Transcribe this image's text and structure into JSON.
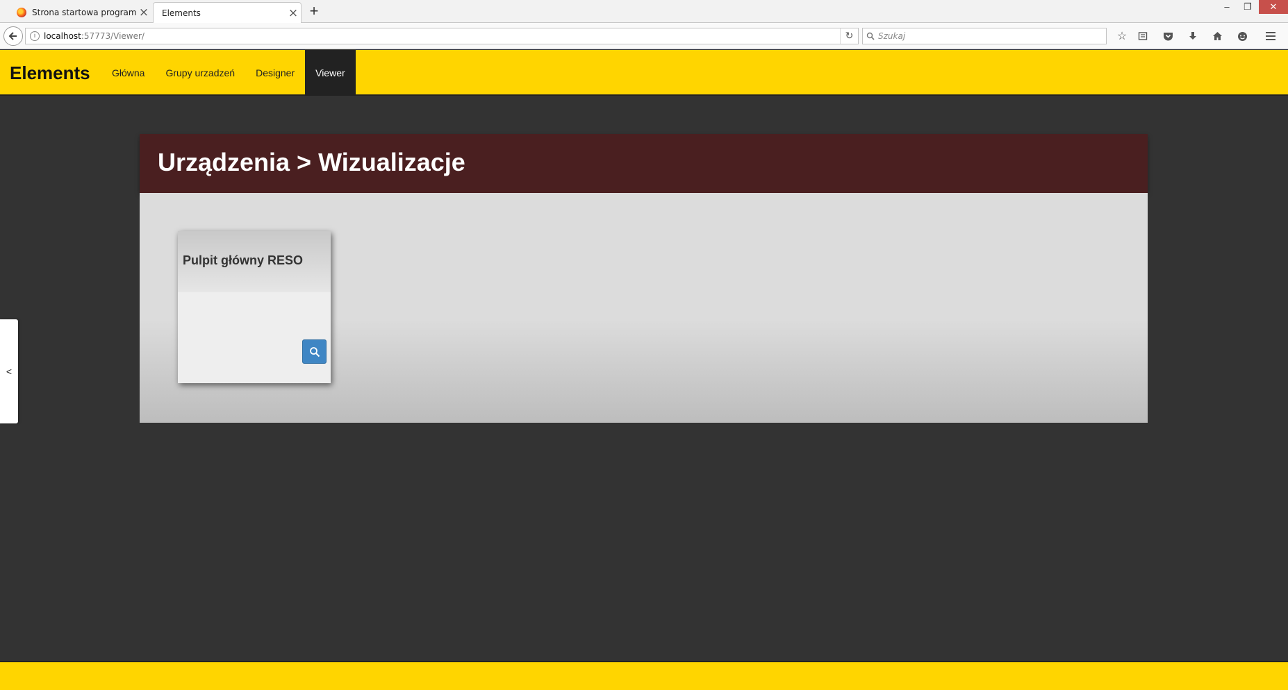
{
  "browser": {
    "tabs": [
      {
        "label": "Strona startowa programu..."
      },
      {
        "label": "Elements"
      }
    ],
    "new_tab_label": "+",
    "url": {
      "host": "localhost",
      "path": ":57773/Viewer/"
    },
    "search_placeholder": "Szukaj",
    "window_controls": {
      "minimize": "–",
      "maximize": "❐",
      "close": "✕"
    }
  },
  "header": {
    "brand": "Elements",
    "menu": [
      {
        "label": "Główna"
      },
      {
        "label": "Grupy urzadzeń"
      },
      {
        "label": "Designer"
      },
      {
        "label": "Viewer",
        "active": true
      }
    ],
    "accent_color": "#ffd500"
  },
  "panel": {
    "title": "Urządzenia > Wizualizacje",
    "header_color": "#4a1f20",
    "cards": [
      {
        "title": "Pulpit główny RESO",
        "button_icon": "search-icon"
      }
    ]
  },
  "side_toggle": {
    "label": "<"
  }
}
